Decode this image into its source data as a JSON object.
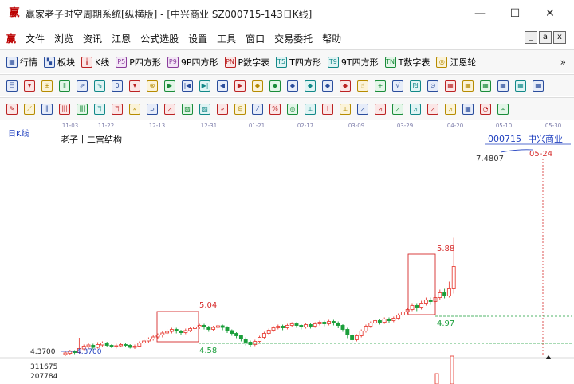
{
  "window": {
    "logo": "赢",
    "title": "赢家老子时空周期系统[纵横版] - [中兴商业  SZ000715-143日K线]",
    "minimize": "—",
    "maximize": "☐",
    "close": "✕"
  },
  "menu": {
    "icon": "赢",
    "items": [
      "文件",
      "浏览",
      "资讯",
      "江恩",
      "公式选股",
      "设置",
      "工具",
      "窗口",
      "交易委托",
      "帮助"
    ],
    "mdi": [
      "_",
      "a",
      "x"
    ]
  },
  "toolbar1": {
    "items": [
      {
        "label": "行情",
        "icon": "grid-icon"
      },
      {
        "label": "板块",
        "icon": "blocks-icon"
      },
      {
        "label": "K线",
        "icon": "candles-icon"
      },
      {
        "label": "P四方形",
        "icon": "p-square-icon",
        "glyph": "P5"
      },
      {
        "label": "9P四方形",
        "icon": "9p-square-icon",
        "glyph": "P9"
      },
      {
        "label": "P数字表",
        "icon": "p-table-icon",
        "glyph": "PN"
      },
      {
        "label": "T四方形",
        "icon": "t-square-icon",
        "glyph": "T5"
      },
      {
        "label": "9T四方形",
        "icon": "9t-square-icon",
        "glyph": "T9"
      },
      {
        "label": "T数字表",
        "icon": "t-table-icon",
        "glyph": "TN"
      },
      {
        "label": "江恩轮",
        "icon": "gann-wheel-icon",
        "glyph": "◎"
      }
    ],
    "more": "»"
  },
  "toolbar2": {
    "glyphs": [
      "日",
      "▾",
      "⊞",
      "Ⅱ",
      "⇗",
      "⇘",
      "0",
      "▾",
      "⊗",
      "▶",
      "|◀",
      "▶|",
      "◀",
      "▶",
      "◆",
      "◆",
      "◆",
      "◆",
      "◆",
      "◆",
      "☝",
      "+",
      "√",
      "₪",
      "⊙",
      "▦",
      "▦",
      "▦",
      "▦",
      "▦",
      "▦"
    ]
  },
  "toolbar3": {
    "glyphs": [
      "✎",
      "⟋",
      "卌",
      "卌",
      "卌",
      "ℸ",
      "ℸ",
      "»",
      "ᴝ",
      "⩘",
      "▨",
      "▨",
      "»",
      "⋹",
      "⁄",
      "%",
      "◎",
      "⟂",
      "Ⅰ",
      "⟂",
      "⩘",
      "⩘",
      "⩘",
      "⩘",
      "⩘",
      "⩘",
      "▦",
      "◔",
      "∞"
    ]
  },
  "chart": {
    "period_label": "日K线",
    "indicator_name": "老子十二宫结构",
    "stock_code": "000715",
    "stock_name": "中兴商业",
    "price_high_label": "7.4807",
    "date_marker": "05-24",
    "date_ticks": [
      "11-03",
      "11-22",
      "12-13",
      "12-31",
      "01-21",
      "02-17",
      "03-09",
      "03-29",
      "04-20",
      "05-10",
      "05-30"
    ],
    "left_axis_label": "4.3700",
    "start_price_label": "4.3700",
    "box_labels": [
      "5.04",
      "4.58",
      "5.88",
      "4.97"
    ],
    "volume_ticks": [
      "311675",
      "207784"
    ],
    "colors": {
      "up": "#e8453c",
      "down": "#1a9e3a",
      "box": "#d62b2b",
      "guide_green": "#1a9e3a",
      "blue_text": "#1f3fbf",
      "dashed_red": "#d62b2b"
    }
  }
}
